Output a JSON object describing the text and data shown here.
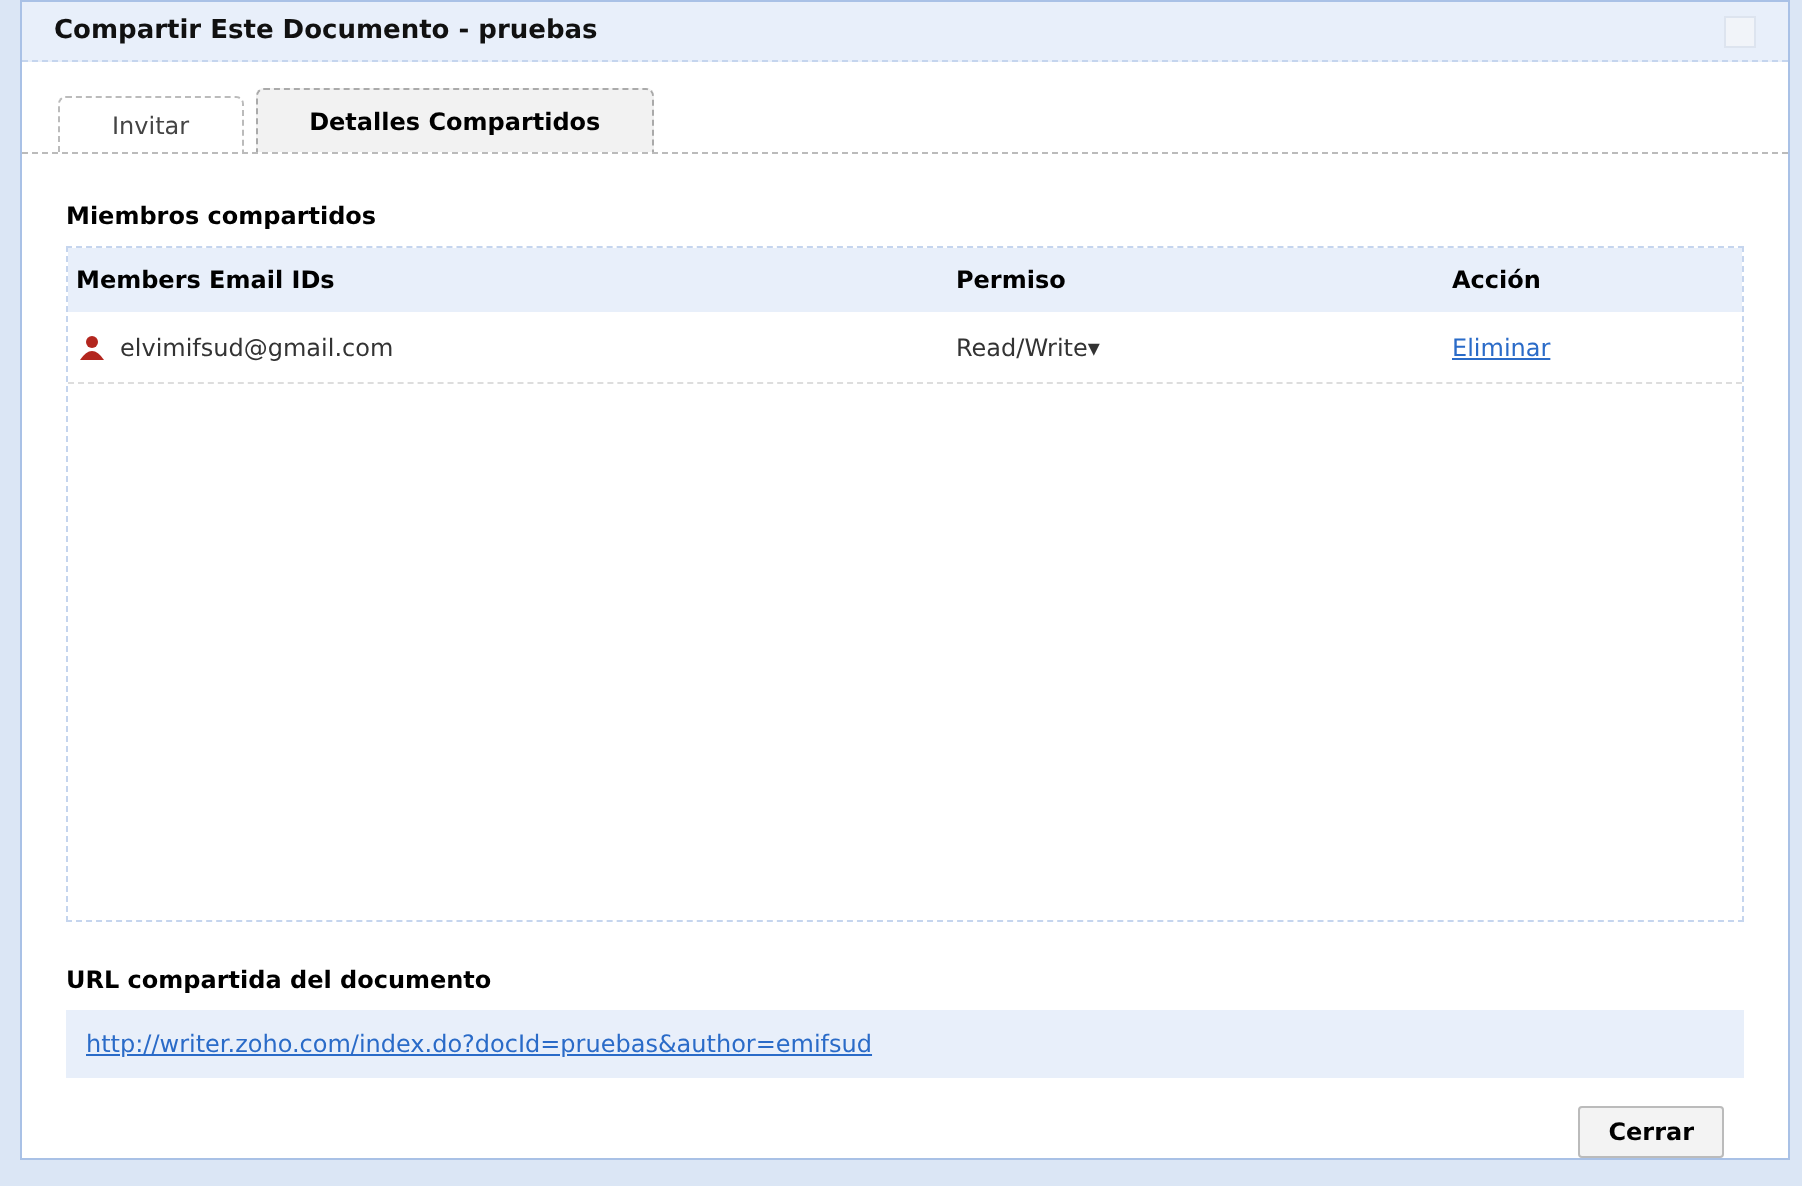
{
  "window": {
    "title": "Compartir Este Documento - pruebas"
  },
  "tabs": [
    {
      "label": "Invitar",
      "selected": false
    },
    {
      "label": "Detalles Compartidos",
      "selected": true
    }
  ],
  "members": {
    "heading": "Miembros compartidos",
    "columns": [
      "Members Email IDs",
      "Permiso",
      "Acción"
    ],
    "rows": [
      {
        "email": "elvimifsud@gmail.com",
        "permission": "Read/Write",
        "permission_caret": "▾",
        "action": "Eliminar"
      }
    ]
  },
  "url_section": {
    "label": "URL compartida del documento",
    "url": "http://writer.zoho.com/index.do?docId=pruebas&author=emifsud"
  },
  "buttons": [
    "Cerrar"
  ]
}
